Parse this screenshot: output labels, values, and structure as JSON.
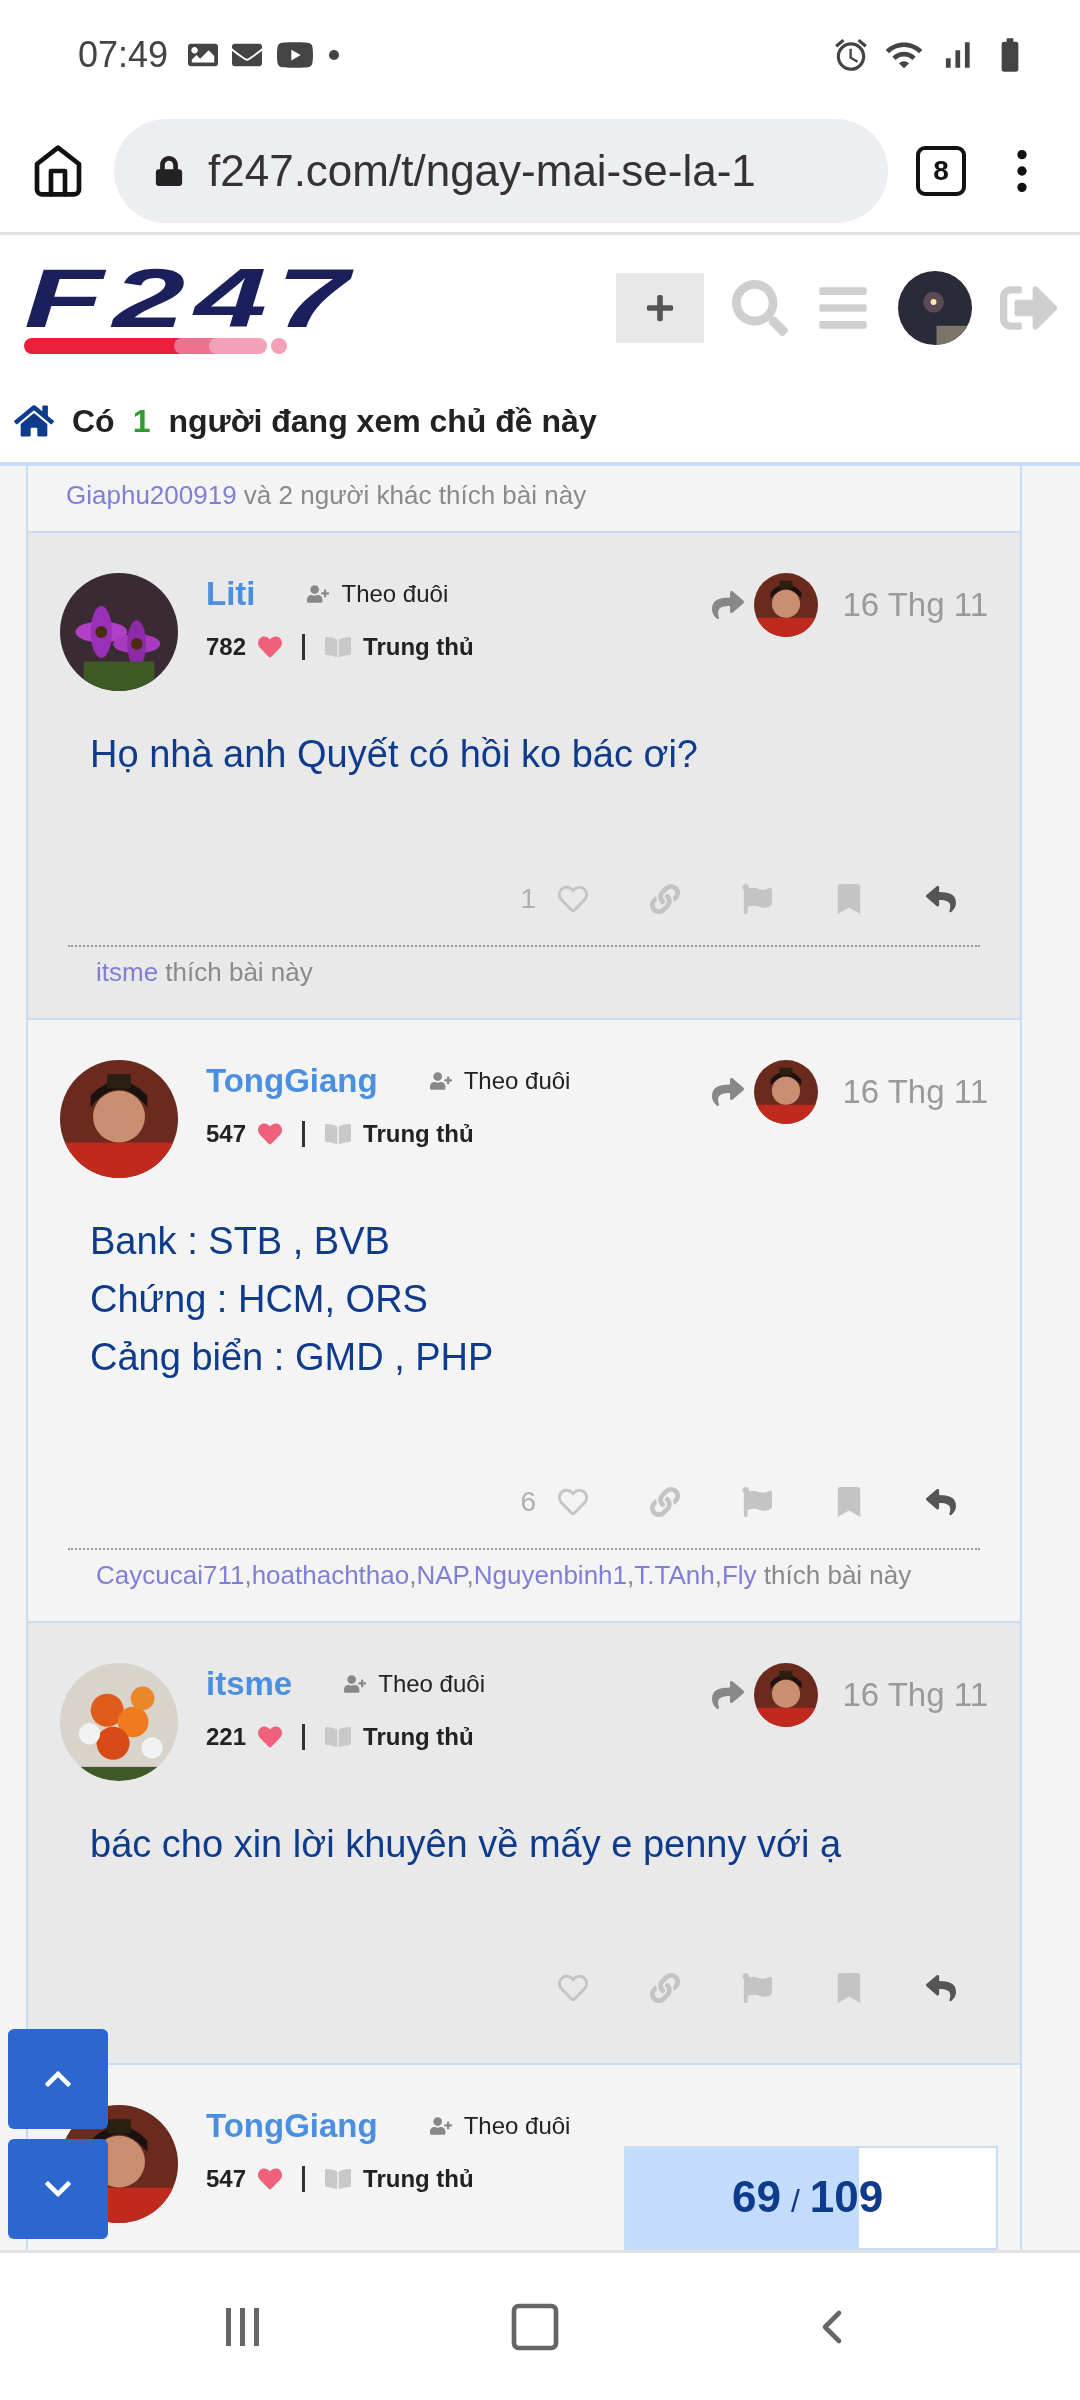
{
  "status_bar": {
    "time": "07:49"
  },
  "browser": {
    "url": "f247.com/t/ngay-mai-se-la-1",
    "tab_count": "8"
  },
  "site": {
    "logo": "F247"
  },
  "viewers": {
    "prefix": "Có",
    "count": "1",
    "suffix": "người đang xem chủ đề này"
  },
  "previous_likes": {
    "users": [
      "Giaphu200919"
    ],
    "suffix": "và 2 người khác thích bài này"
  },
  "posts": [
    {
      "author": "Liti",
      "follow": "Theo đuôi",
      "score": "782",
      "rank": "Trung thủ",
      "date": "16 Thg 11",
      "body": [
        "Họ nhà anh Quyết có hồi ko bác ơi?"
      ],
      "like_count": "1",
      "likes": {
        "users": [
          "itsme"
        ],
        "suffix": "thích bài này"
      }
    },
    {
      "author": "TongGiang",
      "follow": "Theo đuôi",
      "score": "547",
      "rank": "Trung thủ",
      "date": "16 Thg 11",
      "body": [
        "Bank : STB , BVB",
        "Chứng : HCM, ORS",
        "Cảng biển : GMD , PHP"
      ],
      "like_count": "6",
      "likes": {
        "users": [
          "Caycucai711",
          "hoathachthao",
          "NAP",
          "Nguyenbinh1",
          "T.TAnh",
          "Fly"
        ],
        "separator": ",",
        "suffix": "thích bài này"
      }
    },
    {
      "author": "itsme",
      "follow": "Theo đuôi",
      "score": "221",
      "rank": "Trung thủ",
      "date": "16 Thg 11",
      "body": [
        "bác cho xin lời khuyên về mấy e penny với ạ"
      ]
    },
    {
      "author": "TongGiang",
      "follow": "Theo đuôi",
      "score": "547",
      "rank": "Trung thủ"
    }
  ],
  "progress": {
    "current": "69",
    "separator": "/",
    "total": "109",
    "level": 0.63
  }
}
